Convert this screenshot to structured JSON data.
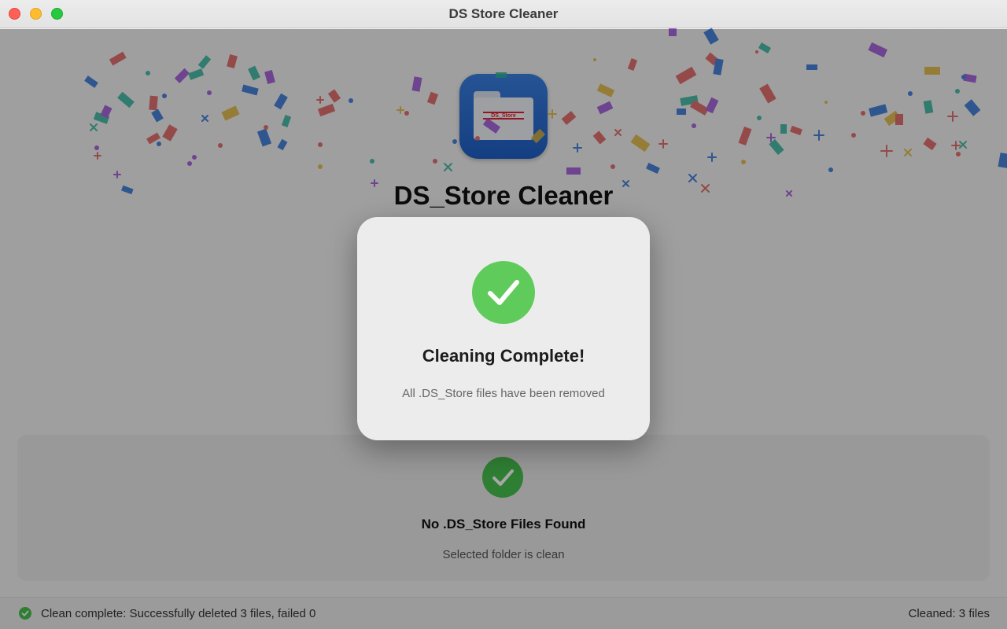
{
  "window": {
    "title": "DS Store Cleaner"
  },
  "app": {
    "name": "DS_Store Cleaner",
    "icon_label": "DS_Store"
  },
  "result_panel": {
    "title": "No .DS_Store Files Found",
    "subtitle": "Selected folder is clean"
  },
  "status_bar": {
    "message": "Clean complete: Successfully deleted 3 files, failed 0",
    "count": "Cleaned: 3 files"
  },
  "dialog": {
    "title": "Cleaning Complete!",
    "message": "All .DS_Store files have been removed"
  },
  "colors": {
    "success_green": "#47c04e",
    "dialog_check_green": "#5fcb5a",
    "icon_blue": "#2a6fd6"
  }
}
